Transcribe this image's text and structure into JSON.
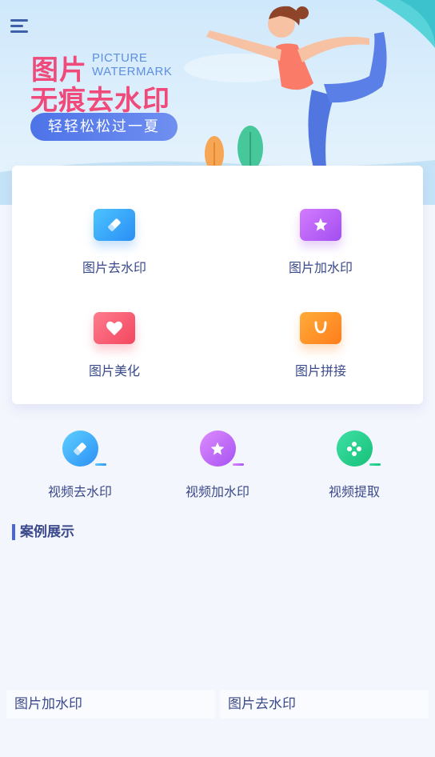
{
  "banner": {
    "title_line1": "图片",
    "title_en_line1": "PICTURE",
    "title_en_line2": "WATERMARK",
    "title_line2": "无痕去水印",
    "pill": "轻轻松松过一夏"
  },
  "tools": [
    {
      "label": "图片去水印",
      "icon": "eraser-icon"
    },
    {
      "label": "图片加水印",
      "icon": "star-icon"
    },
    {
      "label": "图片美化",
      "icon": "heart-icon"
    },
    {
      "label": "图片拼接",
      "icon": "bag-icon"
    }
  ],
  "video_tools": [
    {
      "label": "视频去水印",
      "icon": "eraser-icon"
    },
    {
      "label": "视频加水印",
      "icon": "star-icon"
    },
    {
      "label": "视频提取",
      "icon": "film-reel-icon"
    }
  ],
  "section": {
    "title": "案例展示"
  },
  "cases": [
    {
      "label": "图片加水印"
    },
    {
      "label": "图片去水印"
    }
  ],
  "colors": {
    "accent": "#4967d6",
    "title_pink": "#ef4a7a",
    "text": "#3b4a8a"
  }
}
